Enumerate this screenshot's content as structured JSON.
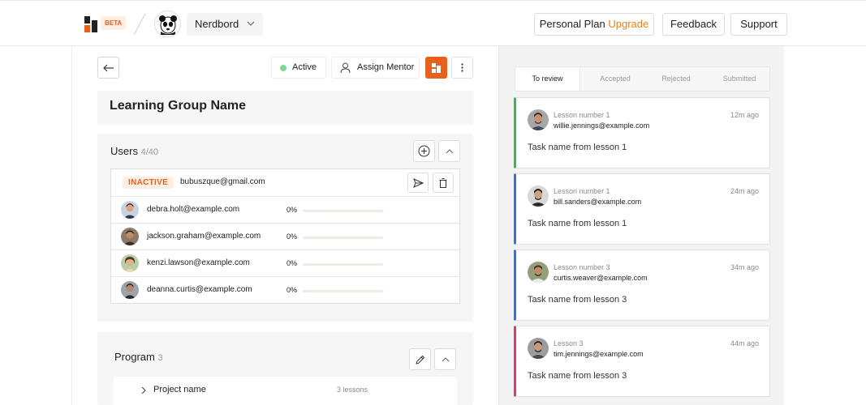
{
  "header": {
    "beta_label": "BETA",
    "org_name": "Nerdbord",
    "plan_label": "Personal Plan",
    "upgrade_label": "Upgrade",
    "feedback_label": "Feedback",
    "support_label": "Support"
  },
  "toolbar": {
    "status_label": "Active",
    "assign_mentor_label": "Assign Mentor"
  },
  "group": {
    "name": "Learning Group Name"
  },
  "users": {
    "title": "Users",
    "count": "4/40",
    "inactive": {
      "badge": "INACTIVE",
      "email": "bubuszque@gmail.com"
    },
    "rows": [
      {
        "email": "debra.holt@example.com",
        "progress": "0%",
        "progress_value": 0
      },
      {
        "email": "jackson.graham@example.com",
        "progress": "0%",
        "progress_value": 0
      },
      {
        "email": "kenzi.lawson@example.com",
        "progress": "0%",
        "progress_value": 0
      },
      {
        "email": "deanna.curtis@example.com",
        "progress": "0%",
        "progress_value": 0
      }
    ]
  },
  "program": {
    "title": "Program",
    "count": "3",
    "projects": [
      {
        "name": "Project name",
        "lessons": "3 lessons"
      }
    ]
  },
  "review": {
    "tabs": [
      "To review",
      "Accepted",
      "Rejected",
      "Submitted"
    ],
    "active_tab": "To review",
    "submissions": [
      {
        "lesson": "Lesson number 1",
        "email": "willie.jennings@example.com",
        "time": "12m ago",
        "task": "Task name from lesson 1",
        "accent": "#34b85a"
      },
      {
        "lesson": "Lesson number 1",
        "email": "bill.sanders@example.com",
        "time": "24m ago",
        "task": "Task name from lesson 1",
        "accent": "#3b6fd4"
      },
      {
        "lesson": "Lesson number 3",
        "email": "curtis.weaver@example.com",
        "time": "34m ago",
        "task": "Task name from lesson 3",
        "accent": "#3b6fd4"
      },
      {
        "lesson": "Lesson 3",
        "email": "tim.jennings@example.com",
        "time": "44m ago",
        "task": "Task name from lesson 3",
        "accent": "#d93a7a"
      }
    ]
  },
  "colors": {
    "brand_orange": "#e8601c",
    "status_active": "#7bd88f",
    "upgrade": "#e8801c"
  },
  "icons": [
    "nerdbord-logo-icon",
    "panda-logo-icon",
    "chevron-down-icon",
    "arrow-left-icon",
    "user-icon",
    "layout-icon",
    "kebab-icon",
    "plus-circle-icon",
    "chevron-up-icon",
    "send-icon",
    "trash-icon",
    "pencil-icon",
    "chevron-right-icon"
  ]
}
